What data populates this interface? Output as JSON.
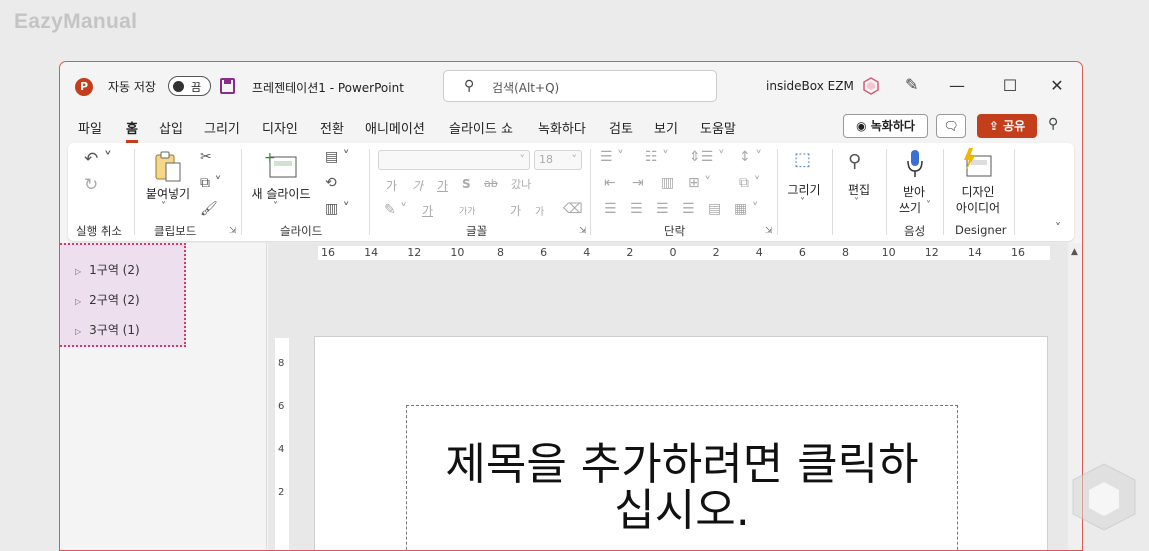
{
  "site_logo": "EazyManual",
  "titlebar": {
    "autosave_label": "자동 저장",
    "autosave_state": "끔",
    "doc_title": "프레젠테이션1  -  PowerPoint",
    "search_placeholder": "검색(Alt+Q)",
    "user_name": "insideBox EZM"
  },
  "menu": [
    "파일",
    "홈",
    "삽입",
    "그리기",
    "디자인",
    "전환",
    "애니메이션",
    "슬라이드 쇼",
    "녹화하다",
    "검토",
    "보기",
    "도움말"
  ],
  "menu_active": "홈",
  "actions": {
    "record": "녹화하다",
    "share": "공유"
  },
  "ribbon": {
    "groups": [
      "실행 취소",
      "클립보드",
      "슬라이드",
      "글꼴",
      "단락",
      "음성",
      "Designer"
    ],
    "paste_label": "붙여넣기",
    "new_slide_label": "새 슬라이드",
    "font_size": "18",
    "draw_label": "그리기",
    "edit_label": "편집",
    "dictate_label1": "받아",
    "dictate_label2": "쓰기",
    "designer_label1": "디자인",
    "designer_label2": "아이디어",
    "font_row1": [
      "가",
      "가",
      "가",
      "S",
      "ab",
      "갔나"
    ],
    "font_row2": [
      "가",
      "가가",
      "가",
      "가"
    ]
  },
  "sections": [
    {
      "label": "1구역 (2)"
    },
    {
      "label": "2구역 (2)"
    },
    {
      "label": "3구역 (1)"
    }
  ],
  "ruler_ticks": [
    "16",
    "14",
    "12",
    "10",
    "8",
    "6",
    "4",
    "2",
    "0",
    "2",
    "4",
    "6",
    "8",
    "10",
    "12",
    "14",
    "16"
  ],
  "vruler_ticks": [
    "8",
    "6",
    "4",
    "2"
  ],
  "slide": {
    "title_line1": "제목을 추가하려면 클릭하",
    "title_line2": "십시오."
  },
  "colors": {
    "accent": "#c43e1c",
    "window_border": "#d55b57",
    "section_highlight": "#d4396d"
  }
}
